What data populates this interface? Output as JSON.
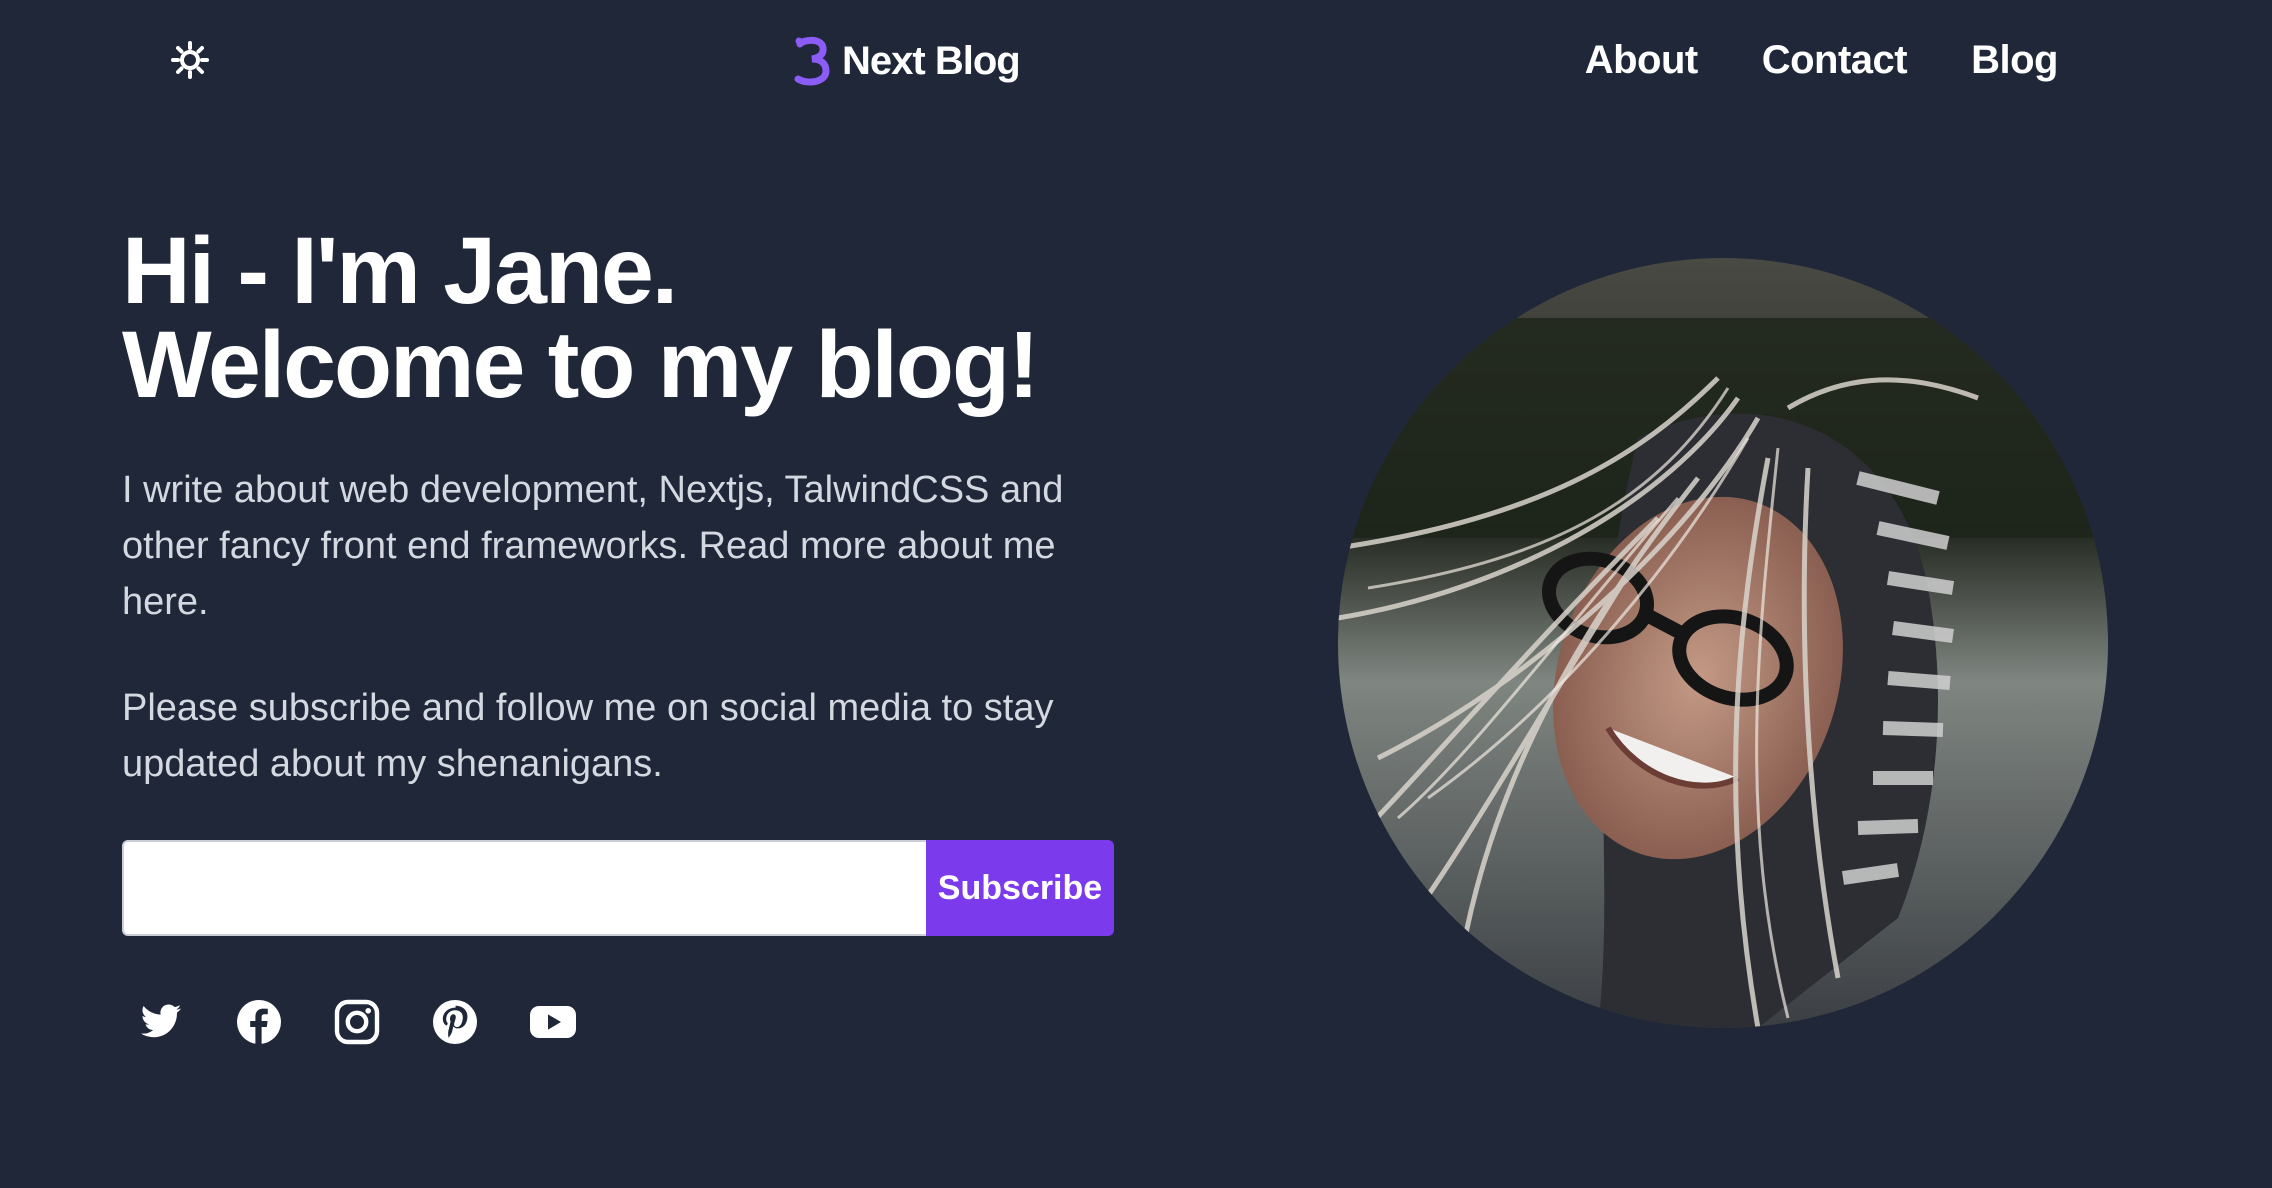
{
  "header": {
    "theme_toggle_icon": "sun-icon",
    "logo": {
      "text": "Next Blog",
      "mark_color": "#8b5cf6"
    },
    "nav": [
      {
        "label": "About"
      },
      {
        "label": "Contact"
      },
      {
        "label": "Blog"
      }
    ]
  },
  "hero": {
    "title_line1": "Hi - I'm Jane.",
    "title_line2": "Welcome to my blog!",
    "intro": "I write about web development, Nextjs, TalwindCSS and other fancy front end frameworks. Read more about me here.",
    "follow_text": "Please subscribe and follow me on social media to stay updated about my shenanigans."
  },
  "subscribe": {
    "input_value": "",
    "button_label": "Subscribe"
  },
  "socials": [
    {
      "icon": "twitter-icon"
    },
    {
      "icon": "facebook-icon"
    },
    {
      "icon": "instagram-icon"
    },
    {
      "icon": "pinterest-icon"
    },
    {
      "icon": "youtube-icon"
    }
  ],
  "portrait": {
    "subject": "portrait photo"
  },
  "colors": {
    "background": "#1f2738",
    "accent": "#7c3aed",
    "text": "#ffffff",
    "muted_text": "#d4d8e0"
  }
}
